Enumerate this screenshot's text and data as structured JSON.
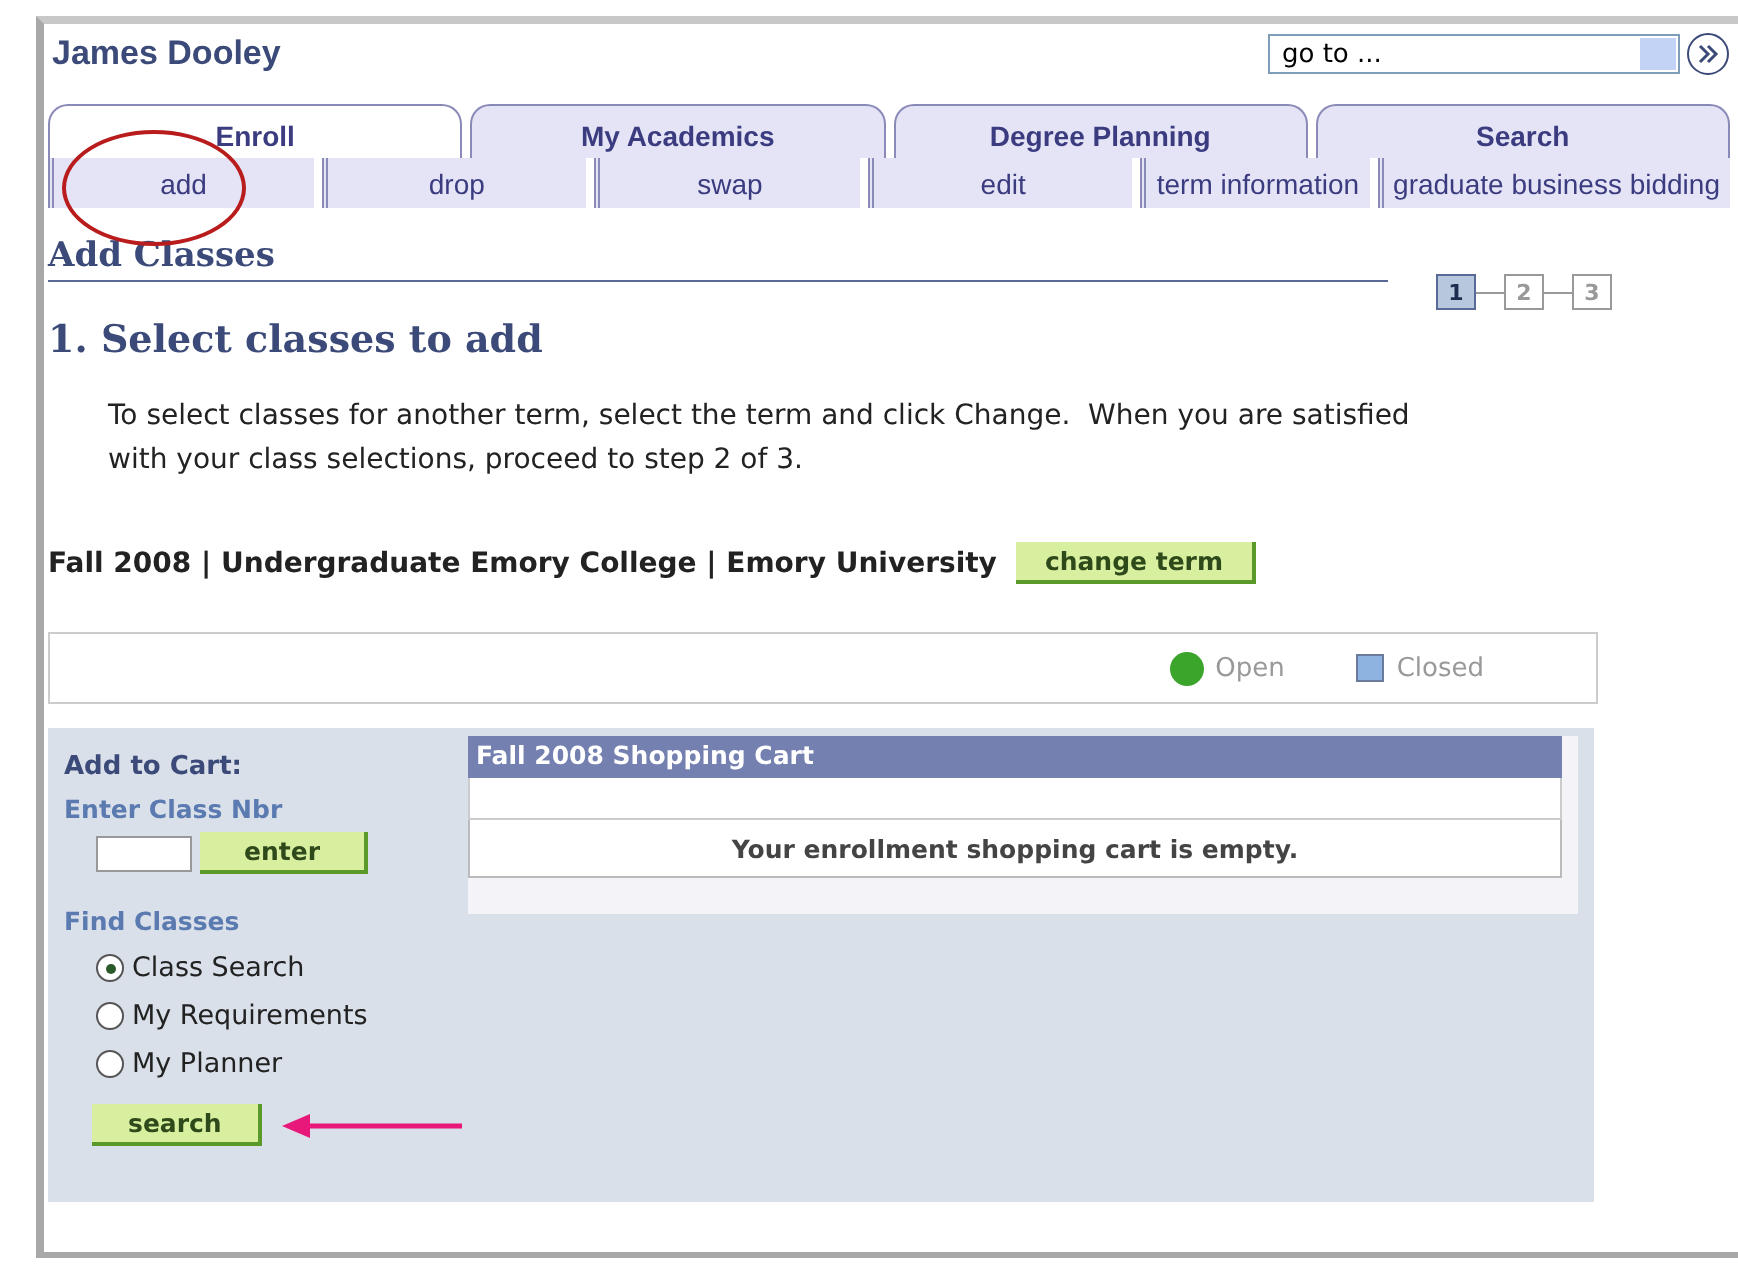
{
  "header": {
    "name": "James Dooley",
    "goto": {
      "value": "go to ..."
    }
  },
  "tabs": [
    {
      "label": "Enroll",
      "selected": true
    },
    {
      "label": "My Academics",
      "selected": false
    },
    {
      "label": "Degree Planning",
      "selected": false
    },
    {
      "label": "Search",
      "selected": false
    }
  ],
  "subtabs": [
    {
      "label": "add"
    },
    {
      "label": "drop"
    },
    {
      "label": "swap"
    },
    {
      "label": "edit"
    },
    {
      "label": "term information"
    },
    {
      "label": "graduate business bidding"
    }
  ],
  "page_title": "Add Classes",
  "steps": [
    {
      "label": "1",
      "selected": true
    },
    {
      "label": "2",
      "selected": false
    },
    {
      "label": "3",
      "selected": false
    }
  ],
  "section_title": "1.  Select classes to add",
  "instructions": "To select classes for another term, select the term and click Change.  When you are satisfied with your class selections, proceed to step 2 of 3.",
  "term": {
    "label": "Fall 2008 | Undergraduate Emory College | Emory University",
    "button": "change term"
  },
  "legend": [
    {
      "label": "Open",
      "kind": "circle",
      "color": "#3aa52a"
    },
    {
      "label": "Closed",
      "kind": "square",
      "color": "#8fb3e0"
    }
  ],
  "add_to_cart": {
    "title": "Add to Cart:",
    "class_nbr_label": "Enter Class Nbr",
    "enter_button": "enter",
    "find_label": "Find Classes",
    "options": [
      {
        "label": "Class Search",
        "selected": true
      },
      {
        "label": "My Requirements",
        "selected": false
      },
      {
        "label": "My Planner",
        "selected": false
      }
    ],
    "search_button": "search"
  },
  "cart": {
    "title": "Fall 2008 Shopping Cart",
    "message": "Your enrollment shopping cart is empty."
  }
}
